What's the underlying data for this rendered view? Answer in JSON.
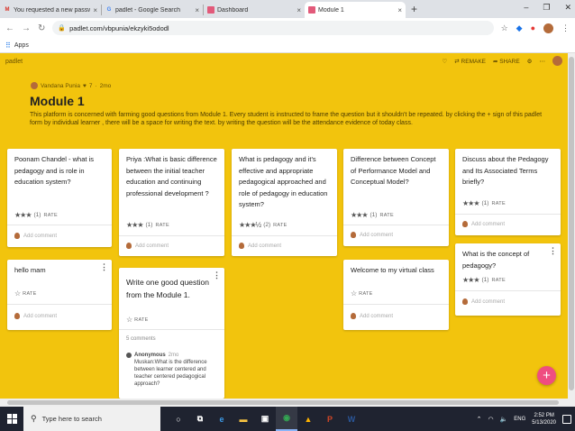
{
  "browser": {
    "tabs": [
      {
        "favicon": "M",
        "title": "You requested a new password ·",
        "active": false,
        "color": "#d93025"
      },
      {
        "favicon": "G",
        "title": "padlet - Google Search",
        "active": false,
        "color": "#4285f4"
      },
      {
        "favicon": "",
        "title": "Dashboard",
        "active": false,
        "color": "#e25a7a"
      },
      {
        "favicon": "",
        "title": "Module 1",
        "active": true,
        "color": "#e25a7a"
      }
    ],
    "new_tab": "+",
    "url": "padlet.com/vbpunia/ekzyki5ododl",
    "bookmarks_apps": "Apps"
  },
  "padlet": {
    "logo": "padlet",
    "actions": {
      "remake": "REMAKE",
      "share": "SHARE"
    },
    "author": "Vandana Punia",
    "likes": "7",
    "age": "2mo",
    "title": "Module 1",
    "description": "This platform is concerned with farming good questions from Module 1. Every student is instructed to frame the question but it shouldn't be repeated. by clicking the + sign of this padlet form by individual learner , there will be a space for writing the text. by writing the question will be the attendance evidence of today class.",
    "rate_label": "RATE",
    "add_comment": "Add comment",
    "posts": [
      {
        "text": "Poonam Chandel - what is pedagogy and is role in education system?",
        "stars": "★★★",
        "count": "(1)"
      },
      {
        "text": "Priya :What is basic difference between the initial teacher education and continuing professional development ?",
        "stars": "★★★",
        "count": "(1)"
      },
      {
        "text": "What is pedagogy and it's effective and appropriate pedagogical approached and role of pedagogy in education system?",
        "stars": "★★★½",
        "count": "(2)"
      },
      {
        "text": "Difference between Concept of Performance Model and Conceptual Model?",
        "stars": "★★★",
        "count": "(1)"
      },
      {
        "text": "Discuss about the Pedagogy and Its Associated Terms  briefly?",
        "stars": "★★★",
        "count": "(1)"
      },
      {
        "text": "hello mam",
        "stars": "☆",
        "count": ""
      },
      {
        "text": "Write one good question from the Module 1.",
        "stars": "☆",
        "count": ""
      },
      {
        "text": "Welcome to my virtual class",
        "stars": "☆",
        "count": ""
      },
      {
        "text": "What is the concept of pedagogy?",
        "stars": "★★★",
        "count": "(1)"
      }
    ],
    "comments_count": "5 comments",
    "reply": {
      "author": "Anonymous",
      "when": "2mo",
      "text": "Muskan:What is the difference between learner centered and teacher centered pedagogical approach?"
    },
    "fab": "+"
  },
  "taskbar": {
    "search_placeholder": "Type here to search",
    "time": "2:52 PM",
    "date": "5/13/2020"
  }
}
